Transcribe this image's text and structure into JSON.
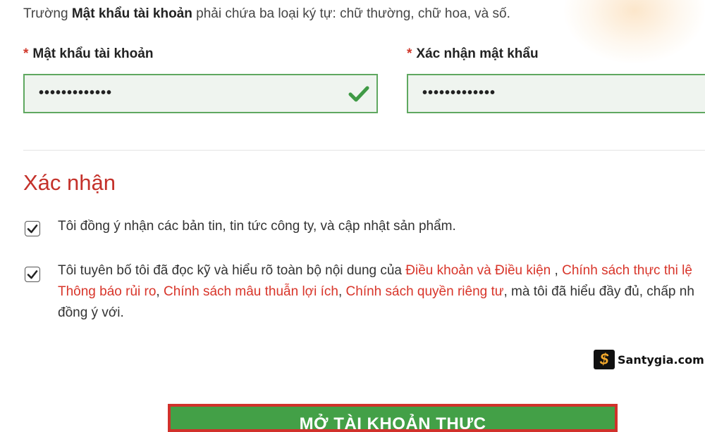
{
  "hint": {
    "prefix": "Trường ",
    "field_name": "Mật khẩu tài khoản",
    "suffix": " phải chứa ba loại ký tự: chữ thường, chữ hoa, và số."
  },
  "password": {
    "required_mark": "*",
    "label": "Mật khẩu tài khoản",
    "value": "•••••••••••••",
    "valid": true
  },
  "confirm_password": {
    "required_mark": "*",
    "label": "Xác nhận mật khẩu",
    "value": "•••••••••••••"
  },
  "confirmation": {
    "title": "Xác nhận",
    "newsletter": {
      "checked": true,
      "text": "Tôi đồng ý nhận các bản tin, tin tức công ty, và cập nhật sản phẩm."
    },
    "terms": {
      "checked": true,
      "line1_prefix": "Tôi tuyên bố tôi đã đọc kỹ và hiểu rõ toàn bộ nội dung của ",
      "link_terms": "Điều khoản và Điều kiện",
      "sep1": " , ",
      "link_execution": "Chính sách thực thi lệ",
      "link_risk": "Thông báo rủi ro",
      "sep2": ", ",
      "link_conflict": "Chính sách mâu thuẫn lợi ích",
      "sep3": ", ",
      "link_privacy": "Chính sách quyền riêng tư",
      "line2_suffix": ", mà tôi đã hiểu đầy đủ, chấp nh",
      "line3": "đồng ý với."
    }
  },
  "submit_button": {
    "label": "MỞ TÀI KHOẢN THỰC"
  },
  "watermark": {
    "logo_glyph": "$",
    "text": "Santygia.com"
  },
  "colors": {
    "accent_red": "#c4312a",
    "link_red": "#d8352a",
    "valid_green": "#5fa860",
    "button_green": "#43a047"
  }
}
